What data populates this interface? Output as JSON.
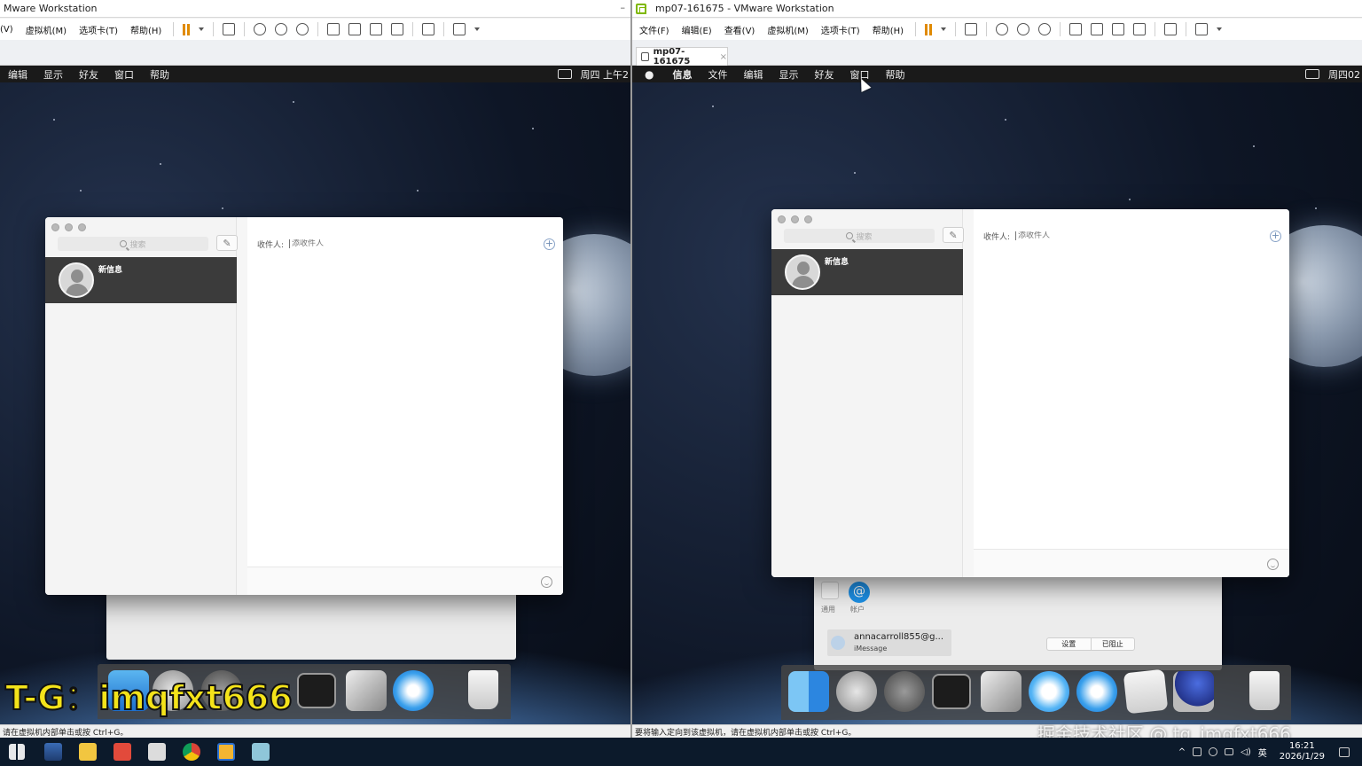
{
  "left_vm": {
    "title": "Mware Workstation",
    "menu": [
      "(V)",
      "虚拟机(M)",
      "选项卡(T)",
      "帮助(H)"
    ],
    "mac_menu": [
      "编辑",
      "显示",
      "好友",
      "窗口",
      "帮助"
    ],
    "clock": "周四 上午2",
    "messages": {
      "search_placeholder": "搜索",
      "to_label": "收件人:",
      "to_placeholder": "添收件人",
      "conversation_name": "新信息"
    },
    "status": "请在虚拟机内部单击或按 Ctrl+G。"
  },
  "right_vm": {
    "title": "mp07-161675 - VMware Workstation",
    "menu": [
      "文件(F)",
      "编辑(E)",
      "查看(V)",
      "虚拟机(M)",
      "选项卡(T)",
      "帮助(H)"
    ],
    "tab": "mp07-161675",
    "mac_menu": [
      "信息",
      "文件",
      "编辑",
      "显示",
      "好友",
      "窗口",
      "帮助"
    ],
    "clock": "周四02",
    "messages": {
      "search_placeholder": "搜索",
      "to_label": "收件人:",
      "to_placeholder": "添收件人",
      "conversation_name": "新信息"
    },
    "prefs": {
      "general": "通用",
      "accounts": "帐户",
      "account_email": "annacarroll855@g...",
      "account_type": "iMessage",
      "settings_btn": "设置",
      "blocked_btn": "已阻止"
    },
    "status": "要将输入定向到该虚拟机，请在虚拟机内部单击或按 Ctrl+G。"
  },
  "overlay": {
    "promo": "T-G：imqfxt666",
    "watermark": "掘金技术社区 @ tg_imqfxt666"
  },
  "taskbar": {
    "ime": "英",
    "time": "16:21",
    "date": "2026/1/29"
  }
}
